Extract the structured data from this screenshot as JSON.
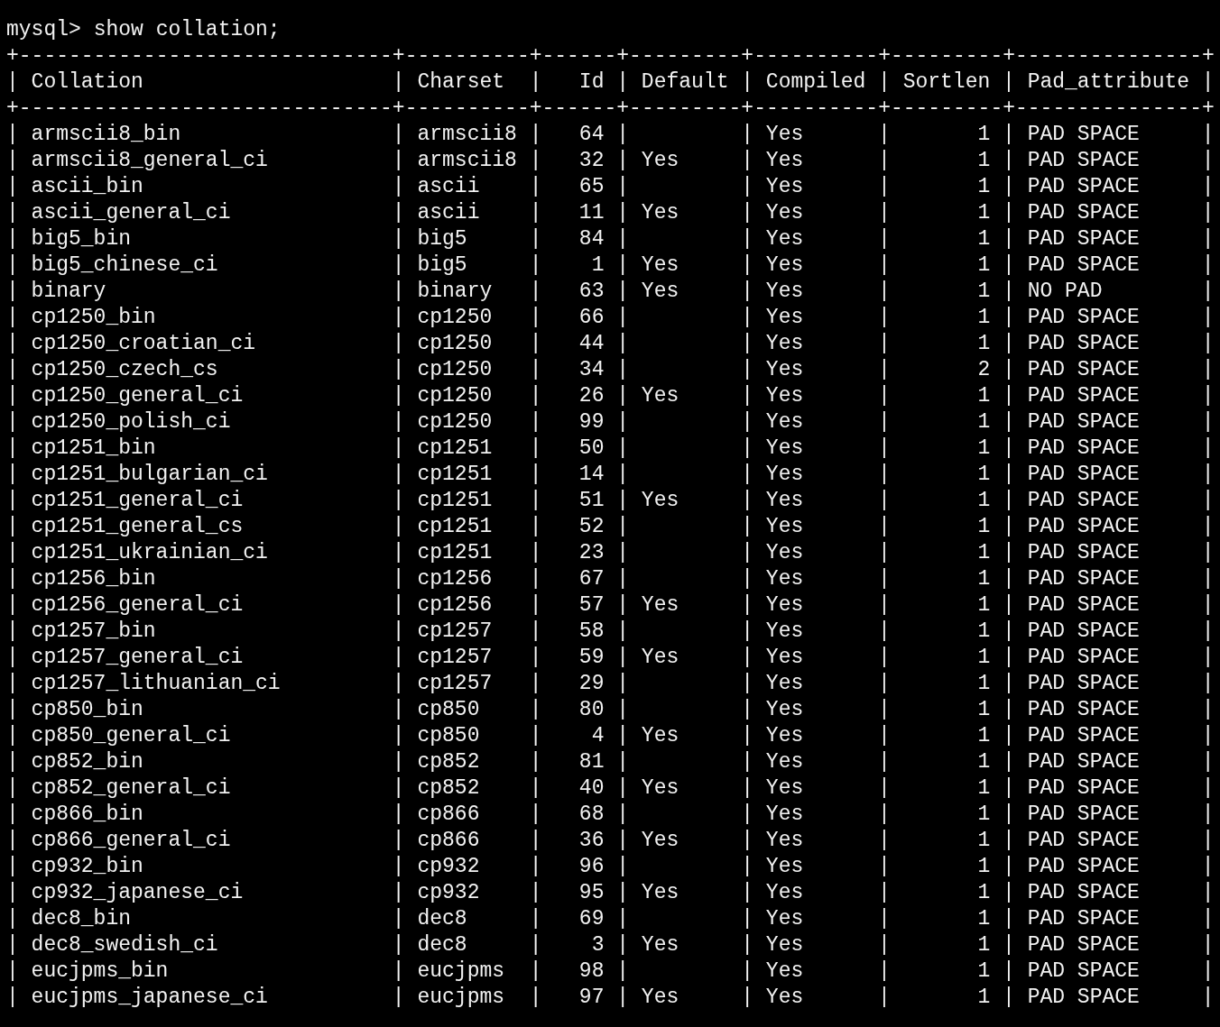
{
  "terminal": {
    "prompt": "mysql>",
    "command": "show collation;",
    "table": {
      "top_rule": "+------------------------------+----------+------+---------+----------+---------+---------------+",
      "header_rule": "+------------------------------+----------+------+---------+----------+---------+---------------+",
      "separator": "|",
      "columns": [
        {
          "label": "Collation",
          "kind": "text"
        },
        {
          "label": "Charset",
          "kind": "text"
        },
        {
          "label": "Id",
          "kind": "number"
        },
        {
          "label": "Default",
          "kind": "text"
        },
        {
          "label": "Compiled",
          "kind": "text"
        },
        {
          "label": "Sortlen",
          "kind": "number"
        },
        {
          "label": "Pad_attribute",
          "kind": "text"
        }
      ],
      "rows": [
        [
          "armscii8_bin",
          "armscii8",
          "64",
          null,
          "Yes",
          "1",
          "PAD SPACE"
        ],
        [
          "armscii8_general_ci",
          "armscii8",
          "32",
          "Yes",
          "Yes",
          "1",
          "PAD SPACE"
        ],
        [
          "ascii_bin",
          "ascii",
          "65",
          null,
          "Yes",
          "1",
          "PAD SPACE"
        ],
        [
          "ascii_general_ci",
          "ascii",
          "11",
          "Yes",
          "Yes",
          "1",
          "PAD SPACE"
        ],
        [
          "big5_bin",
          "big5",
          "84",
          null,
          "Yes",
          "1",
          "PAD SPACE"
        ],
        [
          "big5_chinese_ci",
          "big5",
          "1",
          "Yes",
          "Yes",
          "1",
          "PAD SPACE"
        ],
        [
          "binary",
          "binary",
          "63",
          "Yes",
          "Yes",
          "1",
          "NO PAD"
        ],
        [
          "cp1250_bin",
          "cp1250",
          "66",
          null,
          "Yes",
          "1",
          "PAD SPACE"
        ],
        [
          "cp1250_croatian_ci",
          "cp1250",
          "44",
          null,
          "Yes",
          "1",
          "PAD SPACE"
        ],
        [
          "cp1250_czech_cs",
          "cp1250",
          "34",
          null,
          "Yes",
          "2",
          "PAD SPACE"
        ],
        [
          "cp1250_general_ci",
          "cp1250",
          "26",
          "Yes",
          "Yes",
          "1",
          "PAD SPACE"
        ],
        [
          "cp1250_polish_ci",
          "cp1250",
          "99",
          null,
          "Yes",
          "1",
          "PAD SPACE"
        ],
        [
          "cp1251_bin",
          "cp1251",
          "50",
          null,
          "Yes",
          "1",
          "PAD SPACE"
        ],
        [
          "cp1251_bulgarian_ci",
          "cp1251",
          "14",
          null,
          "Yes",
          "1",
          "PAD SPACE"
        ],
        [
          "cp1251_general_ci",
          "cp1251",
          "51",
          "Yes",
          "Yes",
          "1",
          "PAD SPACE"
        ],
        [
          "cp1251_general_cs",
          "cp1251",
          "52",
          null,
          "Yes",
          "1",
          "PAD SPACE"
        ],
        [
          "cp1251_ukrainian_ci",
          "cp1251",
          "23",
          null,
          "Yes",
          "1",
          "PAD SPACE"
        ],
        [
          "cp1256_bin",
          "cp1256",
          "67",
          null,
          "Yes",
          "1",
          "PAD SPACE"
        ],
        [
          "cp1256_general_ci",
          "cp1256",
          "57",
          "Yes",
          "Yes",
          "1",
          "PAD SPACE"
        ],
        [
          "cp1257_bin",
          "cp1257",
          "58",
          null,
          "Yes",
          "1",
          "PAD SPACE"
        ],
        [
          "cp1257_general_ci",
          "cp1257",
          "59",
          "Yes",
          "Yes",
          "1",
          "PAD SPACE"
        ],
        [
          "cp1257_lithuanian_ci",
          "cp1257",
          "29",
          null,
          "Yes",
          "1",
          "PAD SPACE"
        ],
        [
          "cp850_bin",
          "cp850",
          "80",
          null,
          "Yes",
          "1",
          "PAD SPACE"
        ],
        [
          "cp850_general_ci",
          "cp850",
          "4",
          "Yes",
          "Yes",
          "1",
          "PAD SPACE"
        ],
        [
          "cp852_bin",
          "cp852",
          "81",
          null,
          "Yes",
          "1",
          "PAD SPACE"
        ],
        [
          "cp852_general_ci",
          "cp852",
          "40",
          "Yes",
          "Yes",
          "1",
          "PAD SPACE"
        ],
        [
          "cp866_bin",
          "cp866",
          "68",
          null,
          "Yes",
          "1",
          "PAD SPACE"
        ],
        [
          "cp866_general_ci",
          "cp866",
          "36",
          "Yes",
          "Yes",
          "1",
          "PAD SPACE"
        ],
        [
          "cp932_bin",
          "cp932",
          "96",
          null,
          "Yes",
          "1",
          "PAD SPACE"
        ],
        [
          "cp932_japanese_ci",
          "cp932",
          "95",
          "Yes",
          "Yes",
          "1",
          "PAD SPACE"
        ],
        [
          "dec8_bin",
          "dec8",
          "69",
          null,
          "Yes",
          "1",
          "PAD SPACE"
        ],
        [
          "dec8_swedish_ci",
          "dec8",
          "3",
          "Yes",
          "Yes",
          "1",
          "PAD SPACE"
        ],
        [
          "eucjpms_bin",
          "eucjpms",
          "98",
          null,
          "Yes",
          "1",
          "PAD SPACE"
        ],
        [
          "eucjpms_japanese_ci",
          "eucjpms",
          "97",
          "Yes",
          "Yes",
          "1",
          "PAD SPACE"
        ]
      ]
    }
  }
}
